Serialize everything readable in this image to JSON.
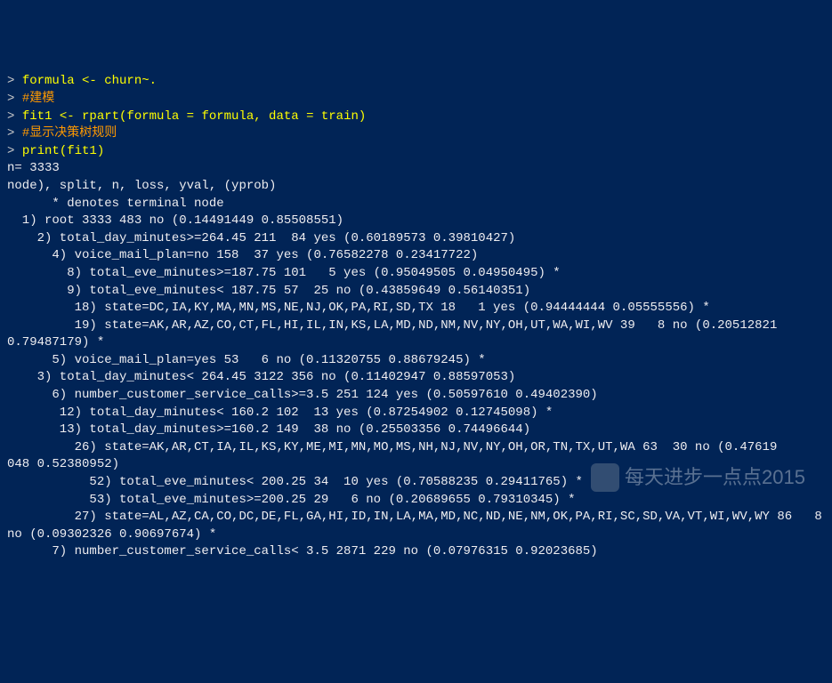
{
  "console": {
    "prompt_char": "> ",
    "commands": [
      {
        "type": "yellow",
        "text": "formula <- churn~."
      },
      {
        "type": "orange",
        "text": "#建模"
      },
      {
        "type": "yellow",
        "text": "fit1 <- rpart(formula = formula, data = train)"
      },
      {
        "type": "orange",
        "text": "#显示决策树规则"
      },
      {
        "type": "yellow",
        "text": "print(fit1)"
      }
    ],
    "output_lines": [
      "n= 3333",
      "",
      "node), split, n, loss, yval, (yprob)",
      "      * denotes terminal node",
      "",
      "  1) root 3333 483 no (0.14491449 0.85508551)",
      "    2) total_day_minutes>=264.45 211  84 yes (0.60189573 0.39810427)",
      "      4) voice_mail_plan=no 158  37 yes (0.76582278 0.23417722)",
      "        8) total_eve_minutes>=187.75 101   5 yes (0.95049505 0.04950495) *",
      "        9) total_eve_minutes< 187.75 57  25 no (0.43859649 0.56140351)",
      "         18) state=DC,IA,KY,MA,MN,MS,NE,NJ,OK,PA,RI,SD,TX 18   1 yes (0.94444444 0.05555556) *",
      "         19) state=AK,AR,AZ,CO,CT,FL,HI,IL,IN,KS,LA,MD,ND,NM,NV,NY,OH,UT,WA,WI,WV 39   8 no (0.20512821",
      "0.79487179) *",
      "      5) voice_mail_plan=yes 53   6 no (0.11320755 0.88679245) *",
      "    3) total_day_minutes< 264.45 3122 356 no (0.11402947 0.88597053)",
      "      6) number_customer_service_calls>=3.5 251 124 yes (0.50597610 0.49402390)",
      "       12) total_day_minutes< 160.2 102  13 yes (0.87254902 0.12745098) *",
      "       13) total_day_minutes>=160.2 149  38 no (0.25503356 0.74496644)",
      "         26) state=AK,AR,CT,IA,IL,KS,KY,ME,MI,MN,MO,MS,NH,NJ,NV,NY,OH,OR,TN,TX,UT,WA 63  30 no (0.47619",
      "048 0.52380952)",
      "           52) total_eve_minutes< 200.25 34  10 yes (0.70588235 0.29411765) *",
      "           53) total_eve_minutes>=200.25 29   6 no (0.20689655 0.79310345) *",
      "         27) state=AL,AZ,CA,CO,DC,DE,FL,GA,HI,ID,IN,LA,MA,MD,NC,ND,NE,NM,OK,PA,RI,SC,SD,VA,VT,WI,WV,WY 86   8",
      "no (0.09302326 0.90697674) *",
      "      7) number_customer_service_calls< 3.5 2871 229 no (0.07976315 0.92023685)"
    ]
  },
  "watermark": {
    "text": "每天进步一点点2015"
  }
}
